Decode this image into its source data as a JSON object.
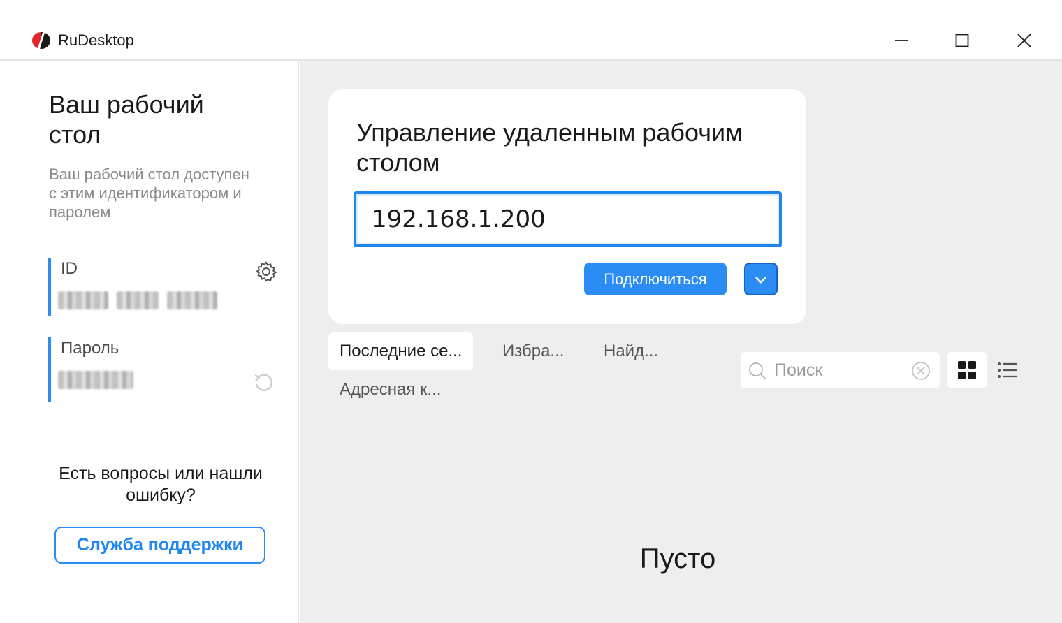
{
  "window": {
    "title": "RuDesktop",
    "logo_icon": "rudesktop-logo-icon",
    "controls": [
      "minimize-icon",
      "maximize-icon",
      "close-icon"
    ]
  },
  "sidebar": {
    "title": "Ваш рабочий стол",
    "description": "Ваш рабочий стол доступен с этим идентификатором и паролем",
    "id_label": "ID",
    "password_label": "Пароль",
    "support_question": "Есть вопросы или нашли ошибку?",
    "support_button": "Служба поддержки"
  },
  "remote": {
    "title": "Управление удаленным рабочим столом",
    "address_value": "192.168.1.200",
    "connect_button": "Подключиться"
  },
  "tabs": [
    {
      "label": "Последние се...",
      "active": true
    },
    {
      "label": "Избра...",
      "active": false
    },
    {
      "label": "Найд...",
      "active": false
    },
    {
      "label": "Адресная к...",
      "active": false
    }
  ],
  "search": {
    "placeholder": "Поиск"
  },
  "empty_state": "Пусто",
  "colors": {
    "accent": "#2b8cf3",
    "background": "#eeeeee",
    "card": "#ffffff",
    "logo_red": "#e3262e"
  }
}
